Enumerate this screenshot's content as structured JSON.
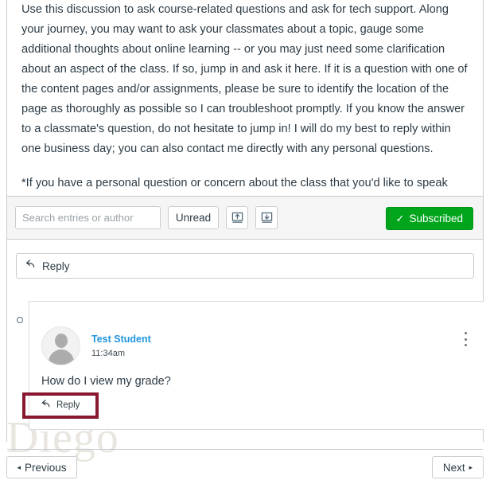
{
  "discussion": {
    "paragraphs": [
      "Use this discussion to ask course-related questions and ask for tech support. Along your journey, you may want to ask your classmates about a topic, gauge some additional thoughts about online learning -- or you may just need some clarification about an aspect of the class. If so, jump in and ask it here. If it is a question with one of the content pages and/or assignments, please be sure to identify the location of the page as thoroughly as possible so I can troubleshoot promptly. If you know the answer to a classmate's question, do not hesitate to jump in! I will do my best to reply within one business day; you can also contact me directly with any personal questions.",
      "*If you have a personal question or concern about the class that you'd like to speak with me about, please  send me a message via the Canvas Inbox tool."
    ]
  },
  "toolbar": {
    "search_placeholder": "Search entries or author",
    "search_value": "",
    "unread_label": "Unread",
    "collapse_threads_icon": "arrow-up-into-box-icon",
    "expand_threads_icon": "arrow-down-into-box-icon",
    "subscribed_label": "Subscribed",
    "subscribed_check": "✓",
    "subscribed_color": "#00A51C"
  },
  "top_reply": {
    "label": "Reply",
    "icon": "reply-arrow-icon"
  },
  "entry": {
    "unread_indicator": "unread-circle",
    "author": "Test Student",
    "author_color": "#2095E0",
    "timestamp": "11:34am",
    "message": "How do I view my grade?",
    "reply_label": "Reply",
    "menu_icon": "kebab-menu-icon",
    "avatar_icon": "default-user-avatar-icon"
  },
  "annotation": {
    "highlight_color": "#8A1730",
    "target": "entry-reply-button"
  },
  "watermark": {
    "text": "n Diego"
  },
  "pagination": {
    "previous_label": "Previous",
    "previous_caret": "◂",
    "next_label": "Next",
    "next_caret": "▸"
  }
}
